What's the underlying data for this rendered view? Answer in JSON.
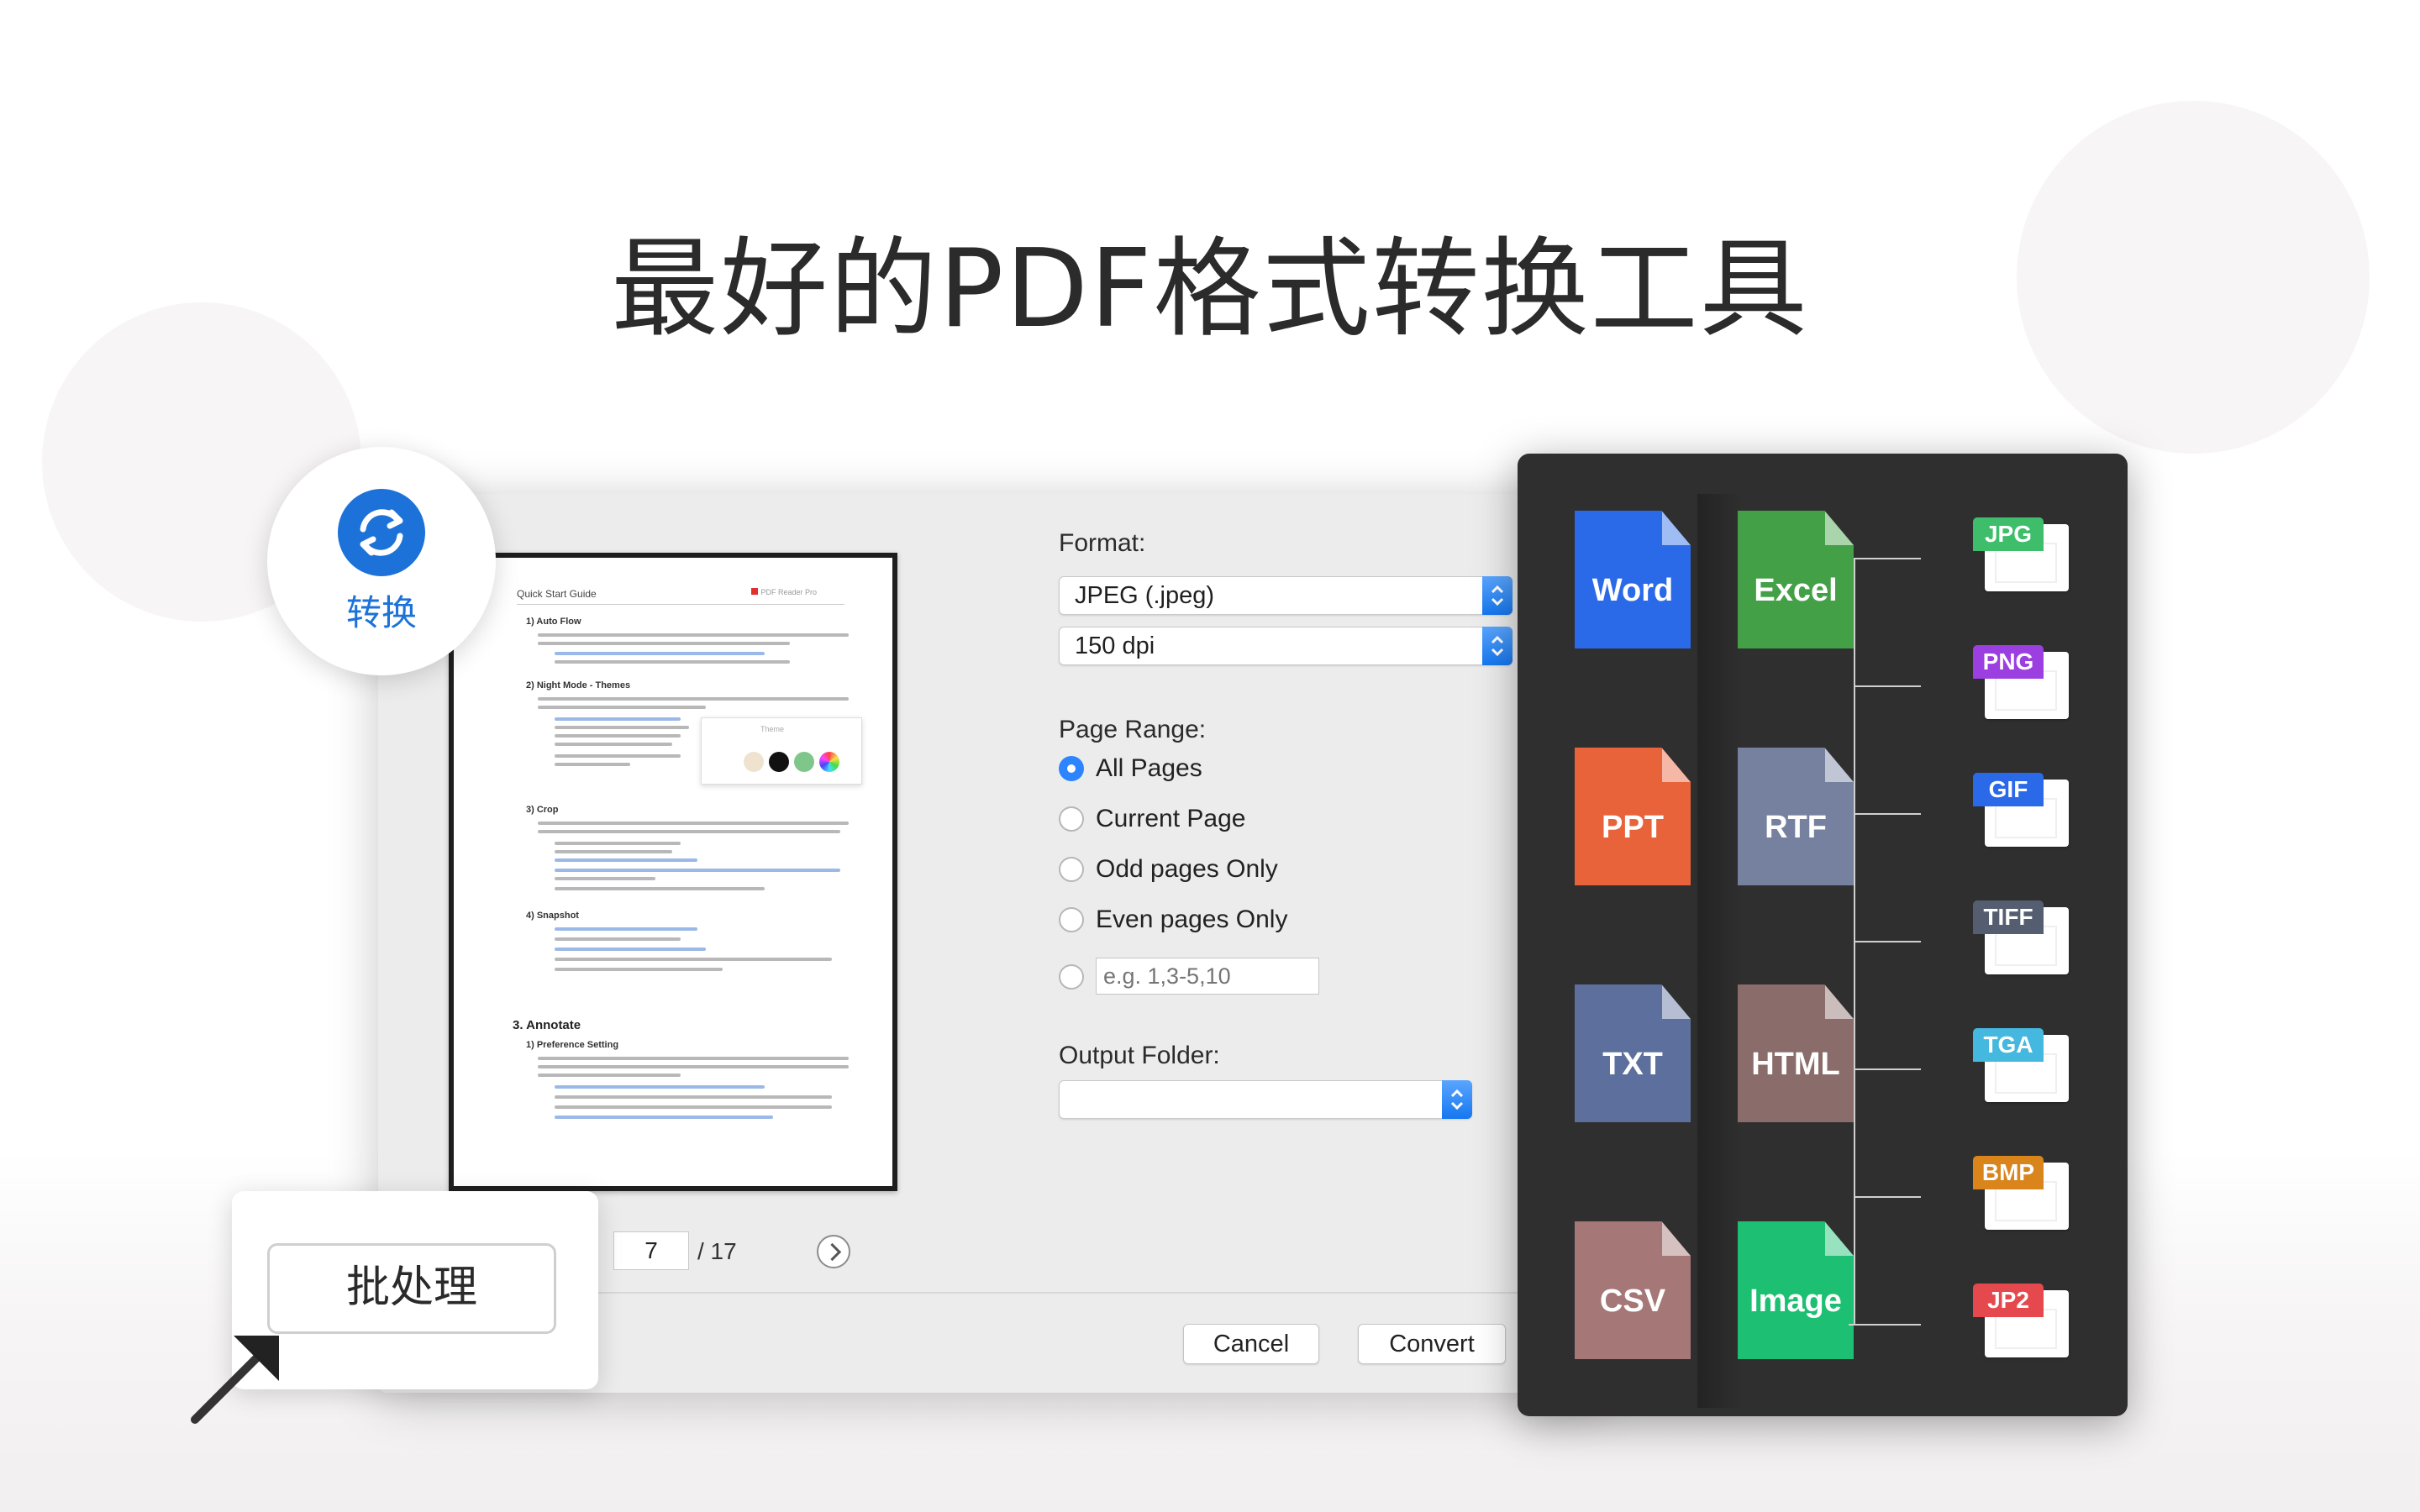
{
  "headline": "最好的PDF格式转换工具",
  "convert_badge": {
    "label": "转换",
    "color": "#1c72d8"
  },
  "batch": {
    "label": "批处理"
  },
  "dialog": {
    "preview": {
      "doc_title": "Quick Start Guide",
      "doc_logo": "PDF Reader Pro",
      "sections": [
        "1) Auto Flow",
        "2) Night Mode - Themes",
        "3) Crop",
        "4) Snapshot"
      ],
      "chapter": "3. Annotate",
      "subsection": "1) Preference Setting",
      "popup_title": "Theme"
    },
    "format": {
      "label": "Format:",
      "value": "JPEG (.jpeg)",
      "dpi_value": "150 dpi"
    },
    "page_range": {
      "label": "Page Range:",
      "options": [
        "All Pages",
        "Current Page",
        "Odd pages Only",
        "Even pages Only"
      ],
      "selected": "All Pages",
      "custom_placeholder": "e.g. 1,3-5,10"
    },
    "output_folder": {
      "label": "Output Folder:",
      "value": ""
    },
    "pagination": {
      "current": "7",
      "total": "/ 17"
    },
    "buttons": {
      "cancel": "Cancel",
      "convert": "Convert"
    }
  },
  "formats": {
    "documents": [
      {
        "label": "Word",
        "color": "#2a6ae9"
      },
      {
        "label": "Excel",
        "color": "#43a047"
      },
      {
        "label": "PPT",
        "color": "#e8623a"
      },
      {
        "label": "RTF",
        "color": "#75819f"
      },
      {
        "label": "TXT",
        "color": "#5c6f9d"
      },
      {
        "label": "HTML",
        "color": "#8a6d6b"
      },
      {
        "label": "CSV",
        "color": "#a57777"
      },
      {
        "label": "Image",
        "color": "#1dbf72"
      }
    ],
    "images": [
      {
        "label": "JPG",
        "color": "#3ebd6b"
      },
      {
        "label": "PNG",
        "color": "#9b3fe0"
      },
      {
        "label": "GIF",
        "color": "#2a6ae9"
      },
      {
        "label": "TIFF",
        "color": "#555e70"
      },
      {
        "label": "TGA",
        "color": "#45b8e0"
      },
      {
        "label": "BMP",
        "color": "#d9851c"
      },
      {
        "label": "JP2",
        "color": "#e5484d"
      }
    ]
  }
}
